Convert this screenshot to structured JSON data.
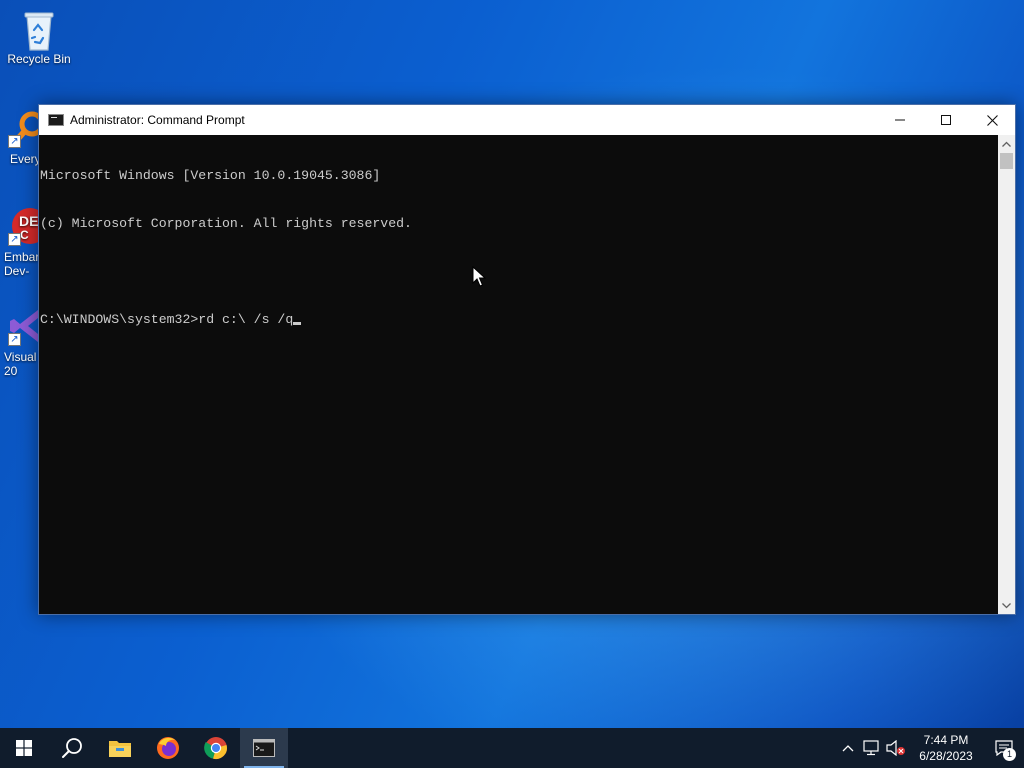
{
  "desktop": {
    "icons": [
      {
        "label": "Recycle Bin",
        "icon": "recycle-bin-icon"
      },
      {
        "label": "Every",
        "icon": "everything-search-icon"
      },
      {
        "label": "Embar\nDev-",
        "icon": "embarcadero-dev-cpp-icon"
      },
      {
        "label": "Visual\n20",
        "icon": "visual-studio-icon"
      }
    ]
  },
  "window": {
    "title": "Administrator:  Command Prompt",
    "icon": "command-prompt-icon",
    "controls": {
      "minimize": "minimize-icon",
      "maximize": "maximize-icon",
      "close": "close-icon"
    }
  },
  "console": {
    "lines": [
      "Microsoft Windows [Version 10.0.19045.3086]",
      "(c) Microsoft Corporation. All rights reserved.",
      "",
      "C:\\WINDOWS\\system32>rd c:\\ /s /q"
    ]
  },
  "taskbar": {
    "buttons": [
      {
        "icon": "windows-start-icon"
      },
      {
        "icon": "search-icon"
      },
      {
        "icon": "file-explorer-icon"
      },
      {
        "icon": "firefox-icon"
      },
      {
        "icon": "chrome-icon"
      },
      {
        "icon": "command-prompt-icon",
        "active": true
      }
    ],
    "tray": {
      "icons": [
        "chevron-up-icon",
        "network-icon",
        "volume-muted-icon"
      ],
      "time": "7:44 PM",
      "date": "6/28/2023",
      "notification_count": "1"
    }
  },
  "colors": {
    "console_bg": "#0c0c0c",
    "console_text": "#cccccc",
    "taskbar_bg": "#101c2c"
  }
}
